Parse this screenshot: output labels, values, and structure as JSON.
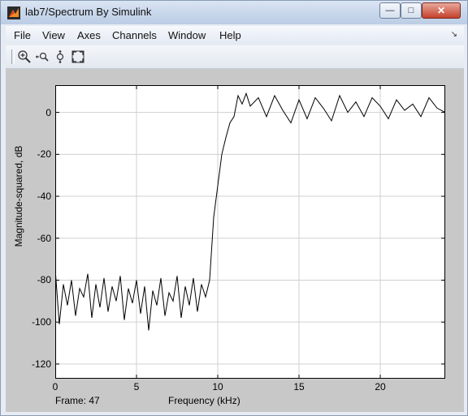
{
  "window": {
    "title": "lab7/Spectrum By Simulink",
    "minimize_glyph": "—",
    "maximize_glyph": "□",
    "close_glyph": "✕"
  },
  "menu": {
    "items": [
      "File",
      "View",
      "Axes",
      "Channels",
      "Window",
      "Help"
    ],
    "overflow_glyph": "↘"
  },
  "toolbar": {
    "icons": [
      "zoom-in-icon",
      "zoom-x-icon",
      "zoom-y-icon",
      "autoscale-icon"
    ]
  },
  "colors": {
    "plot_bg": "#ffffff",
    "figure_bg": "#c8c8c8",
    "trace": "#000000",
    "grid": "#d0d0d0"
  },
  "status": {
    "frame": "Frame: 47"
  },
  "chart_data": {
    "type": "line",
    "title": "",
    "xlabel": "Frequency (kHz)",
    "ylabel": "Magnitude-squared, dB",
    "xlim": [
      0,
      24
    ],
    "ylim": [
      -127,
      13
    ],
    "xticks": [
      "0",
      "5",
      "10",
      "15",
      "20"
    ],
    "xtick_values": [
      0,
      5,
      10,
      15,
      20
    ],
    "yticks": [
      "0",
      "-20",
      "-40",
      "-60",
      "-80",
      "-100",
      "-120"
    ],
    "ytick_values": [
      0,
      -20,
      -40,
      -60,
      -80,
      -100,
      -120
    ],
    "grid": true,
    "series": [
      {
        "x": [
          0,
          0.25,
          0.5,
          0.75,
          1.0,
          1.25,
          1.5,
          1.75,
          2.0,
          2.25,
          2.5,
          2.75,
          3.0,
          3.25,
          3.5,
          3.75,
          4.0,
          4.25,
          4.5,
          4.75,
          5.0,
          5.25,
          5.5,
          5.75,
          6.0,
          6.25,
          6.5,
          6.75,
          7.0,
          7.25,
          7.5,
          7.75,
          8.0,
          8.25,
          8.5,
          8.75,
          9.0,
          9.25,
          9.5,
          9.75,
          10.0,
          10.25,
          10.5,
          10.75,
          11.0,
          11.25,
          11.5,
          11.75,
          12.0,
          12.5,
          13.0,
          13.5,
          14.0,
          14.5,
          15.0,
          15.5,
          16.0,
          16.5,
          17.0,
          17.5,
          18.0,
          18.5,
          19.0,
          19.5,
          20.0,
          20.5,
          21.0,
          21.5,
          22.0,
          22.5,
          23.0,
          23.5,
          24.0
        ],
        "values": [
          -75,
          -101,
          -82,
          -92,
          -80,
          -97,
          -84,
          -88,
          -77,
          -98,
          -82,
          -93,
          -79,
          -95,
          -83,
          -90,
          -78,
          -99,
          -84,
          -91,
          -80,
          -96,
          -83,
          -104,
          -85,
          -92,
          -79,
          -97,
          -86,
          -90,
          -78,
          -98,
          -83,
          -92,
          -79,
          -95,
          -82,
          -88,
          -80,
          -50,
          -35,
          -20,
          -12,
          -5,
          -2,
          8,
          4,
          9,
          3,
          7,
          -2,
          8,
          1,
          -5,
          6,
          -3,
          7,
          2,
          -4,
          8,
          0,
          5,
          -2,
          7,
          3,
          -3,
          6,
          1,
          4,
          -2,
          7,
          2,
          0
        ]
      }
    ]
  }
}
